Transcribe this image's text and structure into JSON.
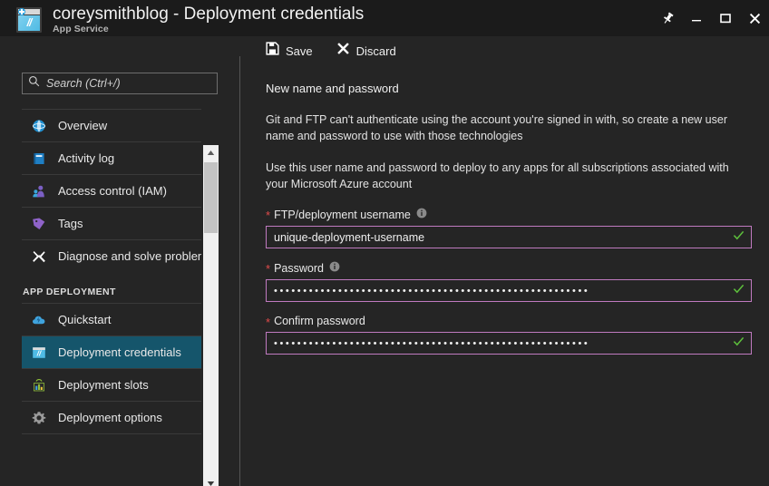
{
  "window": {
    "title": "coreysmithblog - Deployment credentials",
    "subtitle": "App Service",
    "app_icon": "app-service-icon",
    "icon_glyph": "//",
    "controls": [
      {
        "name": "pin-icon",
        "label": "Pin"
      },
      {
        "name": "minimize-icon",
        "label": "Minimize"
      },
      {
        "name": "maximize-icon",
        "label": "Maximize"
      },
      {
        "name": "close-icon",
        "label": "Close"
      }
    ]
  },
  "toolbar": {
    "save_label": "Save",
    "save_icon": "save-floppy-icon",
    "discard_label": "Discard",
    "discard_icon": "close-x-icon"
  },
  "sidebar": {
    "search": {
      "placeholder": "Search (Ctrl+/)",
      "value": "",
      "icon": "search-icon"
    },
    "items": [
      {
        "label": "Overview",
        "icon": "globe-icon",
        "selected": false
      },
      {
        "label": "Activity log",
        "icon": "activity-log-icon",
        "selected": false
      },
      {
        "label": "Access control (IAM)",
        "icon": "access-control-people-icon",
        "selected": false
      },
      {
        "label": "Tags",
        "icon": "tag-icon",
        "selected": false
      },
      {
        "label": "Diagnose and solve problems",
        "icon": "wrench-screwdriver-icon",
        "selected": false
      }
    ],
    "section_header": "APP DEPLOYMENT",
    "deployment_items": [
      {
        "label": "Quickstart",
        "icon": "cloud-lightning-icon",
        "selected": false
      },
      {
        "label": "Deployment credentials",
        "icon": "app-service-icon",
        "selected": true
      },
      {
        "label": "Deployment slots",
        "icon": "bar-chart-icon",
        "selected": false
      },
      {
        "label": "Deployment options",
        "icon": "gear-icon",
        "selected": false
      }
    ],
    "scrollbar": {
      "up_icon": "scroll-up-arrow-icon",
      "down_icon": "scroll-down-arrow-icon"
    }
  },
  "main": {
    "heading": "New name and password",
    "paragraph1": "Git and FTP can't authenticate using the account you're signed in with, so create a new user name and password to use with those technologies",
    "paragraph2": "Use this user name and password to deploy to any apps for all subscriptions associated with your Microsoft Azure account",
    "fields": [
      {
        "label": "FTP/deployment username",
        "required": true,
        "has_info": true,
        "type": "text",
        "value": "unique-deployment-username",
        "valid": true
      },
      {
        "label": "Password",
        "required": true,
        "has_info": true,
        "type": "password",
        "value": "••••••••••••••••••••••••••••••••••••••••••••••••••••••",
        "valid": true
      },
      {
        "label": "Confirm password",
        "required": true,
        "has_info": false,
        "type": "password",
        "value": "••••••••••••••••••••••••••••••••••••••••••••••••••••••",
        "valid": true
      }
    ]
  },
  "colors": {
    "background": "#252525",
    "titlebar": "#1b1b1b",
    "selected_nav": "#15556b",
    "input_border": "#c07ac0",
    "required_asterisk": "#e04b4b",
    "valid_check": "#5dbf3c",
    "scrollbar_track": "#f0f0f0",
    "scrollbar_thumb": "#c3c3c3"
  }
}
